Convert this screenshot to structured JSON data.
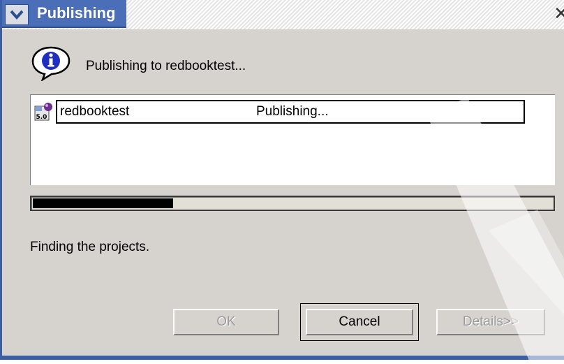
{
  "window": {
    "title": "Publishing",
    "close_glyph": "✕"
  },
  "message": {
    "text": "Publishing to redbooktest...",
    "icon": "info-icon"
  },
  "servers": [
    {
      "name": "redbooktest",
      "status": "Publishing...",
      "icon": "server-5-0-icon",
      "icon_label": "5.0"
    }
  ],
  "progress": {
    "fraction": 0.27
  },
  "status_message": "Finding the projects.",
  "buttons": {
    "ok": "OK",
    "cancel": "Cancel",
    "details": "Details>>"
  },
  "colors": {
    "title_bar": "#4a6fb8",
    "dialog_bg": "#d6d3ce",
    "progress_fill": "#000000"
  }
}
